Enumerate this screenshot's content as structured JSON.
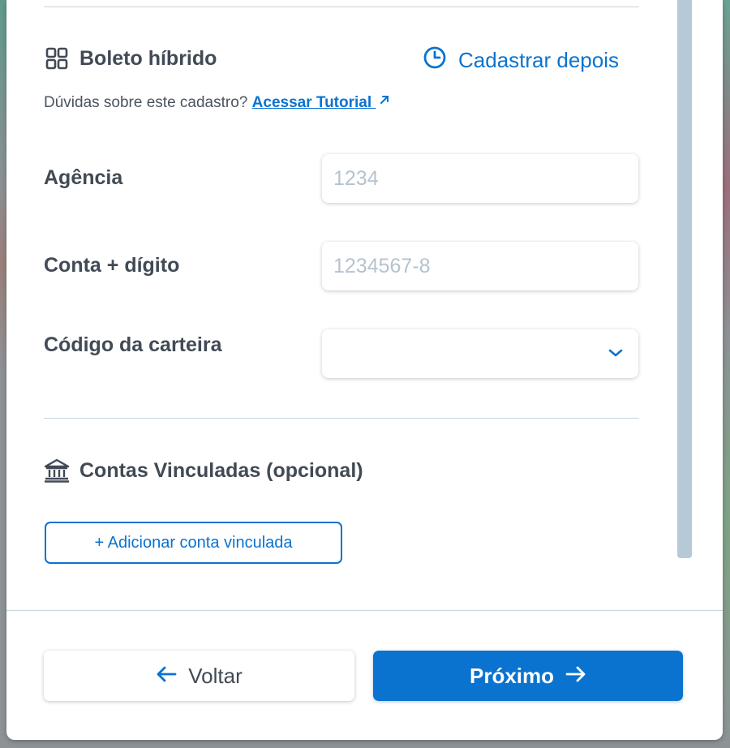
{
  "colors": {
    "accent": "#0a73cf",
    "text": "#414a55",
    "placeholder": "#b5c3cf",
    "scrollbar": "#b6c9d6"
  },
  "boleto": {
    "icon": "grid-icon",
    "title": "Boleto híbrido",
    "later_icon": "clock-icon",
    "later_label": "Cadastrar depois",
    "help_text": "Dúvidas sobre este cadastro?",
    "tutorial_label": "Acessar Tutorial",
    "tutorial_icon": "external-arrow-icon"
  },
  "fields": {
    "agencia": {
      "label": "Agência",
      "value": "",
      "placeholder": "1234"
    },
    "conta": {
      "label": "Conta + dígito",
      "value": "",
      "placeholder": "1234567-8"
    },
    "carteira": {
      "label": "Código da carteira",
      "selected": "",
      "icon": "chevron-down-icon"
    }
  },
  "linked": {
    "icon": "bank-icon",
    "title": "Contas Vinculadas (opcional)",
    "add_label": "+ Adicionar conta vinculada"
  },
  "footer": {
    "back_label": "Voltar",
    "back_icon": "arrow-left-icon",
    "next_label": "Próximo",
    "next_icon": "arrow-right-icon"
  }
}
